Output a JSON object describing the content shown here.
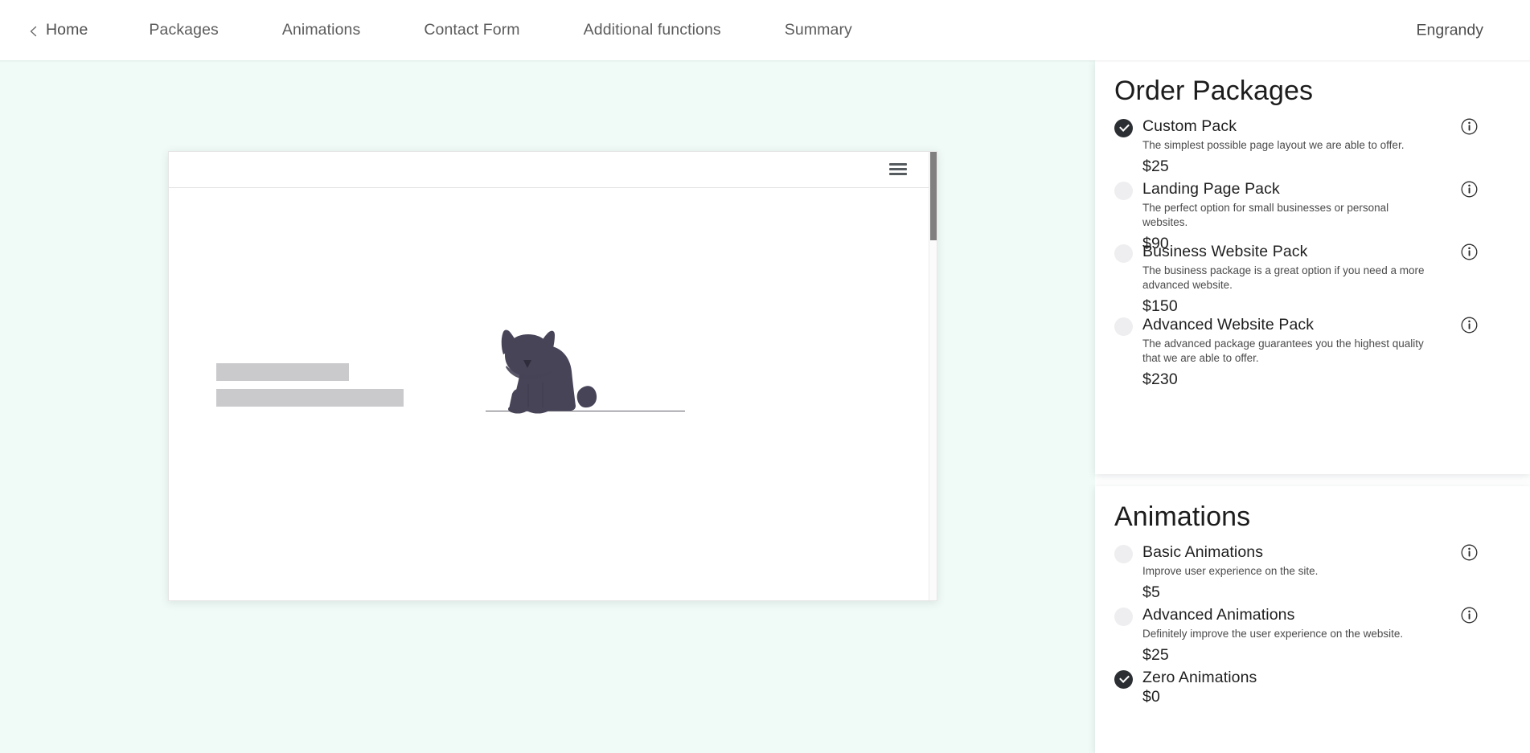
{
  "header": {
    "back_label": "Home",
    "back_icon": "chevron-left-icon",
    "nav_items": [
      {
        "label": "Packages"
      },
      {
        "label": "Animations"
      },
      {
        "label": "Contact Form"
      },
      {
        "label": "Additional functions"
      },
      {
        "label": "Summary"
      }
    ],
    "brand": "Engrandy"
  },
  "preview": {
    "menu_icon": "hamburger-menu-icon",
    "illustration": "sitting-cat-illustration",
    "placeholder_bars": 2,
    "scrollbar": "vertical-scrollbar"
  },
  "packages_card": {
    "title": "Order Packages",
    "options": [
      {
        "name": "Custom Pack",
        "description": "The simplest possible page layout we are able to offer.",
        "price": "$25",
        "selected": true,
        "info_icon": "info-circle-icon"
      },
      {
        "name": "Landing Page Pack",
        "description": "The perfect option for small businesses or personal websites.",
        "price": "$90",
        "selected": false,
        "info_icon": "info-circle-icon"
      },
      {
        "name": "Business Website Pack",
        "description": "The business package is a great option if you need a more advanced website.",
        "price": "$150",
        "selected": false,
        "info_icon": "info-circle-icon"
      },
      {
        "name": "Advanced Website Pack",
        "description": "The advanced package guarantees you the highest quality that we are able to offer.",
        "price": "$230",
        "selected": false,
        "info_icon": "info-circle-icon"
      }
    ]
  },
  "animations_card": {
    "title": "Animations",
    "options": [
      {
        "name": "Basic Animations",
        "description": "Improve user experience on the site.",
        "price": "$5",
        "selected": false,
        "info_icon": "info-circle-icon"
      },
      {
        "name": "Advanced Animations",
        "description": "Definitely improve the user experience on the website.",
        "price": "$25",
        "selected": false,
        "info_icon": "info-circle-icon"
      },
      {
        "name": "Zero Animations",
        "description": "",
        "price": "$0",
        "selected": true,
        "info_icon": ""
      }
    ]
  },
  "colors": {
    "canvas_background": "#f0fbf7",
    "card_background": "#ffffff",
    "selected_radio": "#2b2f33",
    "unselected_radio": "#eeeef0",
    "cat_body": "#474458",
    "placeholder_bar": "#cacacd",
    "nav_text": "#5c5c5c"
  }
}
